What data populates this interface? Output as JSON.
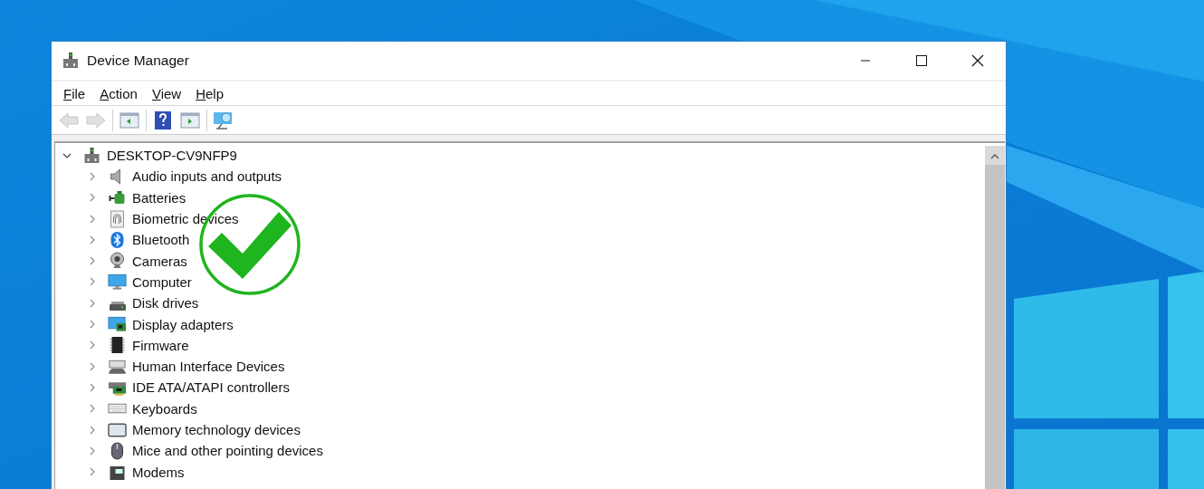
{
  "window": {
    "title": "Device Manager"
  },
  "menu": [
    {
      "label": "File"
    },
    {
      "label": "Action"
    },
    {
      "label": "View"
    },
    {
      "label": "Help"
    }
  ],
  "toolbar": [
    {
      "kind": "back",
      "disabled": true
    },
    {
      "kind": "forward",
      "disabled": true
    },
    {
      "kind": "separator"
    },
    {
      "kind": "panel-left",
      "disabled": false
    },
    {
      "kind": "separator"
    },
    {
      "kind": "help",
      "disabled": false
    },
    {
      "kind": "panel-right",
      "disabled": false
    },
    {
      "kind": "separator"
    },
    {
      "kind": "scan",
      "disabled": false
    }
  ],
  "tree": {
    "label": "DESKTOP-CV9NFP9",
    "expanded": true,
    "children": [
      {
        "label": "Audio inputs and outputs",
        "kind": "audio",
        "expanded": false
      },
      {
        "label": "Batteries",
        "kind": "battery",
        "expanded": false
      },
      {
        "label": "Biometric devices",
        "kind": "biometric",
        "expanded": false
      },
      {
        "label": "Bluetooth",
        "kind": "bluetooth",
        "expanded": false
      },
      {
        "label": "Cameras",
        "kind": "camera",
        "expanded": false
      },
      {
        "label": "Computer",
        "kind": "computer",
        "expanded": false
      },
      {
        "label": "Disk drives",
        "kind": "disk",
        "expanded": false
      },
      {
        "label": "Display adapters",
        "kind": "display",
        "expanded": false
      },
      {
        "label": "Firmware",
        "kind": "firmware",
        "expanded": false
      },
      {
        "label": "Human Interface Devices",
        "kind": "hid",
        "expanded": false
      },
      {
        "label": "IDE ATA/ATAPI controllers",
        "kind": "ide",
        "expanded": false
      },
      {
        "label": "Keyboards",
        "kind": "keyboard",
        "expanded": false
      },
      {
        "label": "Memory technology devices",
        "kind": "memory",
        "expanded": false
      },
      {
        "label": "Mice and other pointing devices",
        "kind": "mouse",
        "expanded": false
      },
      {
        "label": "Modems",
        "kind": "modem",
        "expanded": false
      }
    ]
  }
}
